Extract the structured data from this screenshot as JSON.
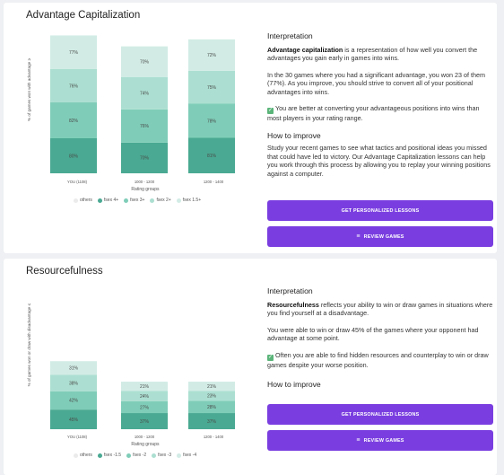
{
  "colors": {
    "accent": "#7a3ee0",
    "seg4": "#4aa992",
    "seg3": "#7fcdb8",
    "seg2": "#acdfd1",
    "seg1": "#d2ece5",
    "others": "#ebebeb",
    "check": "#5bb57a"
  },
  "capitalization": {
    "title": "Advantage Capitalization",
    "y_axis_label": "% of games won with advantage ≥",
    "x_axis_title": "Rating groups",
    "x_ticks": [
      "YOU (1108)",
      "1000 - 1200",
      "1200 - 1400"
    ],
    "legend": [
      "others",
      "fsex 4+",
      "fsex 3+",
      "fsex 2+",
      "fsex 1.5+"
    ],
    "interpretation_heading": "Interpretation",
    "intro_bold": "Advantage capitalization",
    "intro_rest": " is a representation of how well you convert the advantages you gain early in games into wins.",
    "stats_text": "In the 30 games where you had a significant advantage, you won 23 of them (77%). As you improve, you should strive to convert all of your positional advantages into wins.",
    "feedback": "You are better at converting your advantageous positions into wins than most players in your rating range.",
    "check_icon": "✓",
    "improve_heading": "How to improve",
    "improve_text": "Study your recent games to see what tactics and positional ideas you missed that could have led to victory. Our Advantage Capitalization lessons can help you work through this process by allowing you to replay your winning positions against a computer.",
    "btn_lessons": "GET PERSONALIZED LESSONS",
    "btn_review": "REVIEW GAMES",
    "review_icon": "≡"
  },
  "resourcefulness": {
    "title": "Resourcefulness",
    "y_axis_label": "% of games won or draw with disadvantage ≤",
    "x_axis_title": "Rating groups",
    "x_ticks": [
      "YOU (1108)",
      "1000 - 1200",
      "1200 - 1400"
    ],
    "legend": [
      "others",
      "fsex -1.5",
      "fsex -2",
      "fsex -3",
      "fsex -4"
    ],
    "interpretation_heading": "Interpretation",
    "intro_bold": "Resourcefulness",
    "intro_rest": " reflects your ability to win or draw games in situations where you find yourself at a disadvantage.",
    "stats_text": "You were able to win or draw 45% of the games where your opponent had advantage at some point.",
    "feedback": "Often you are able to find hidden resources and counterplay to win or draw games despite your worse position.",
    "check_icon": "✓",
    "improve_heading": "How to improve",
    "btn_lessons": "GET PERSONALIZED LESSONS",
    "btn_review": "REVIEW GAMES",
    "review_icon": "≡"
  },
  "chart_data": [
    {
      "type": "bar",
      "stacked": true,
      "categories": [
        "YOU (1108)",
        "1000 - 1200",
        "1200 - 1400"
      ],
      "series": [
        {
          "name": "fsex 4+",
          "values": [
            80,
            70,
            81
          ]
        },
        {
          "name": "fsex 3+",
          "values": [
            82,
            76,
            78
          ]
        },
        {
          "name": "fsex 2+",
          "values": [
            76,
            74,
            75
          ]
        },
        {
          "name": "fsex 1.5+",
          "values": [
            77,
            70,
            72
          ]
        }
      ],
      "xlabel": "Rating groups",
      "ylabel": "% of games won with advantage ≥"
    },
    {
      "type": "bar",
      "stacked": true,
      "categories": [
        "YOU (1108)",
        "1000 - 1200",
        "1200 - 1400"
      ],
      "series": [
        {
          "name": "fsex -1.5",
          "values": [
            45,
            37,
            37
          ]
        },
        {
          "name": "fsex -2",
          "values": [
            42,
            27,
            28
          ]
        },
        {
          "name": "fsex -3",
          "values": [
            38,
            24,
            23
          ]
        },
        {
          "name": "fsex -4",
          "values": [
            31,
            21,
            21
          ]
        }
      ],
      "xlabel": "Rating groups",
      "ylabel": "% of games won or draw with disadvantage ≤"
    }
  ]
}
